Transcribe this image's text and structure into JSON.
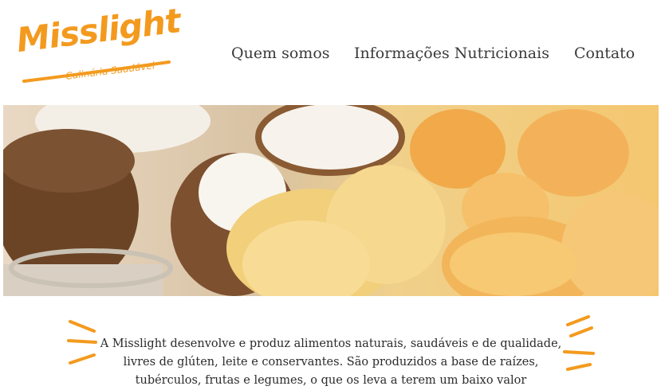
{
  "logo": {
    "name": "Misslight",
    "tagline": "Culinária Saudável"
  },
  "nav": [
    {
      "label": "Quem somos"
    },
    {
      "label": "Informações Nutricionais"
    },
    {
      "label": "Contato"
    }
  ],
  "intro": {
    "text": "A Misslight desenvolve e produz alimentos naturais, saudáveis e de qualidade, livres de glúten, leite e conservantes. São produzidos a base de raízes, tubérculos, frutas e legumes, o que os leva a terem um baixo valor"
  },
  "colors": {
    "brand": "#f39a1e",
    "nav_text": "#3a3a3a"
  }
}
